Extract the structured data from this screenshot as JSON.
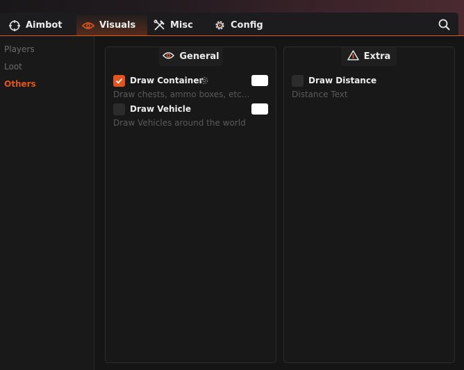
{
  "tabs": [
    {
      "label": "Aimbot",
      "icon": "crosshair-icon"
    },
    {
      "label": "Visuals",
      "icon": "eye-icon",
      "active": true
    },
    {
      "label": "Misc",
      "icon": "tools-icon"
    },
    {
      "label": "Config",
      "icon": "gear-icon"
    }
  ],
  "search_icon": "search-icon",
  "sidebar": {
    "items": [
      {
        "label": "Players"
      },
      {
        "label": "Loot"
      },
      {
        "label": "Others",
        "active": true
      }
    ]
  },
  "panels": {
    "general": {
      "title": "General",
      "icon": "eye-icon",
      "options": [
        {
          "label": "Draw Container",
          "description": "Draw chests, ammo boxes, etc...",
          "checked": true,
          "has_settings": true,
          "color": "#ffffff"
        },
        {
          "label": "Draw Vehicle",
          "description": "Draw Vehicles around the world",
          "checked": false,
          "color": "#ffffff"
        }
      ]
    },
    "extra": {
      "title": "Extra",
      "icon": "warning-icon",
      "options": [
        {
          "label": "Draw Distance",
          "description": "Distance Text",
          "checked": false
        }
      ]
    }
  },
  "colors": {
    "accent": "#e2561e",
    "background": "#151515",
    "panel": "#181818"
  }
}
